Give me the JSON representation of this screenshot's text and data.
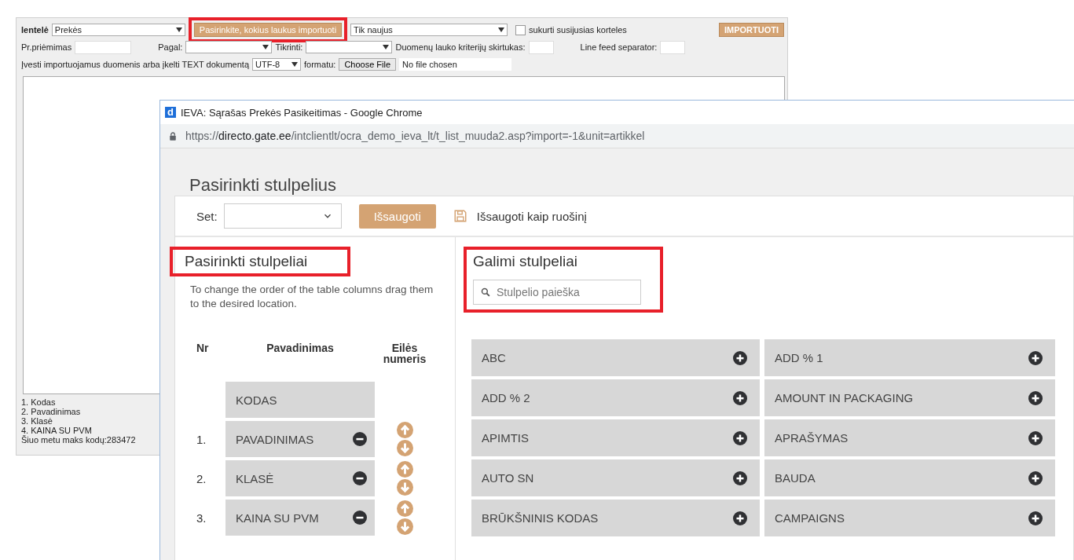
{
  "import_form": {
    "table_label": "lentelė",
    "table_select": "Prekės",
    "choose_fields_button": {
      "label": "Pasirinkite,  kokius laukus importuoti",
      "highlighted": true
    },
    "mode_select": "Tik naujus",
    "related_cards": {
      "label": "sukurti susijusias korteles",
      "checked": false
    },
    "import_button": "IMPORTUOTI",
    "receipt_label": "Pr.priėmimas",
    "by_label": "Pagal:",
    "check_label": "Tikrinti:",
    "separator_label": "Duomenų lauko kriterijų skirtukas:",
    "line_feed_label": "Line feed separator:",
    "enter_label": "Įvesti importuojamus duomenis arba įkelti TEXT dokumentą",
    "encoding_select": "UTF-8",
    "format_label": "formatu:",
    "file_button": "Choose File",
    "file_status": "No file chosen",
    "notes": [
      "1. Kodas",
      "2. Pavadinimas",
      "3. Klasė",
      "4. KAINA SU PVM",
      "Šiuo metu maks kodų:283472"
    ]
  },
  "popup": {
    "app_icon": "d",
    "title": "IEVA: Sąrašas Prekės Pasikeitimas - Google Chrome",
    "url": {
      "scheme": "https://",
      "host": "directo.gate.ee",
      "path": "/intclientlt/ocra_demo_ieva_lt/t_list_muuda2.asp?import=-1&unit=artikkel"
    },
    "heading": "Pasirinkti stulpelius",
    "toolbar": {
      "set_label": "Set:",
      "save_button": "Išsaugoti",
      "save_as_template": "Išsaugoti kaip ruošinį"
    },
    "selected_columns": {
      "heading": "Pasirinkti stulpeliai",
      "highlighted": true,
      "hint": "To change the order of the table columns drag them to the desired location.",
      "columns": [
        "Nr",
        "Pavadinimas",
        "Eilės numeris"
      ],
      "rows": [
        {
          "nr": "",
          "name": "KODAS",
          "removable": false
        },
        {
          "nr": "1.",
          "name": "PAVADINIMAS",
          "removable": true
        },
        {
          "nr": "2.",
          "name": "KLASĖ",
          "removable": true
        },
        {
          "nr": "3.",
          "name": "KAINA SU PVM",
          "removable": true
        }
      ]
    },
    "available_columns": {
      "heading": "Galimi stulpeliai",
      "highlighted": true,
      "search_placeholder": "Stulpelio paieška",
      "items": [
        "ABC",
        "ADD % 1",
        "ADD % 2",
        "AMOUNT IN PACKAGING",
        "APIMTIS",
        "APRAŠYMAS",
        "AUTO SN",
        "BAUDA",
        "BRŪKŠNINIS KODAS",
        "CAMPAIGNS"
      ]
    }
  }
}
